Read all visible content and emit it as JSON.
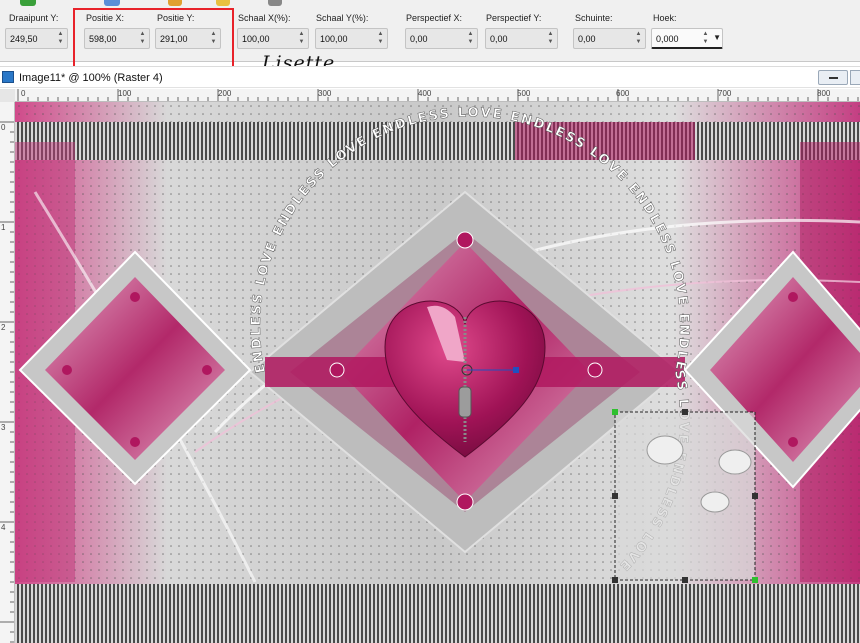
{
  "toolbar": {
    "fields": [
      {
        "label": "Draaipunt Y:",
        "value": "249,50"
      },
      {
        "label": "Positie X:",
        "value": "598,00"
      },
      {
        "label": "Positie Y:",
        "value": "291,00"
      },
      {
        "label": "Schaal X(%):",
        "value": "100,00"
      },
      {
        "label": "Schaal Y(%):",
        "value": "100,00"
      },
      {
        "label": "Perspectief X:",
        "value": "0,00"
      },
      {
        "label": "Perspectief Y:",
        "value": "0,00"
      },
      {
        "label": "Schuinte:",
        "value": "0,00"
      },
      {
        "label": "Hoek:",
        "value": "0,000"
      }
    ]
  },
  "annotation": {
    "signature": "Lisette"
  },
  "window": {
    "title": "Image11* @ 100% (Raster 4)"
  },
  "ruler": {
    "horizontal_labels": [
      "0",
      "100",
      "200",
      "300",
      "400",
      "500",
      "600",
      "700",
      "800"
    ],
    "vertical_labels": [
      "0",
      "1",
      "2",
      "3",
      "4"
    ]
  },
  "artwork": {
    "motto_text": "ENDLESS LOVE ENDLESS LOVE ENDLESS LOVE ENDLESS LOVE ENDLESS LOVE ENDLESS LOVE ENDLESS LOVE",
    "colors": {
      "magenta": "#b0175f",
      "pink": "#e58ab4",
      "silver": "#bdbdbd",
      "highlight": "#e8222a",
      "transform_green": "#2ec02e"
    }
  }
}
